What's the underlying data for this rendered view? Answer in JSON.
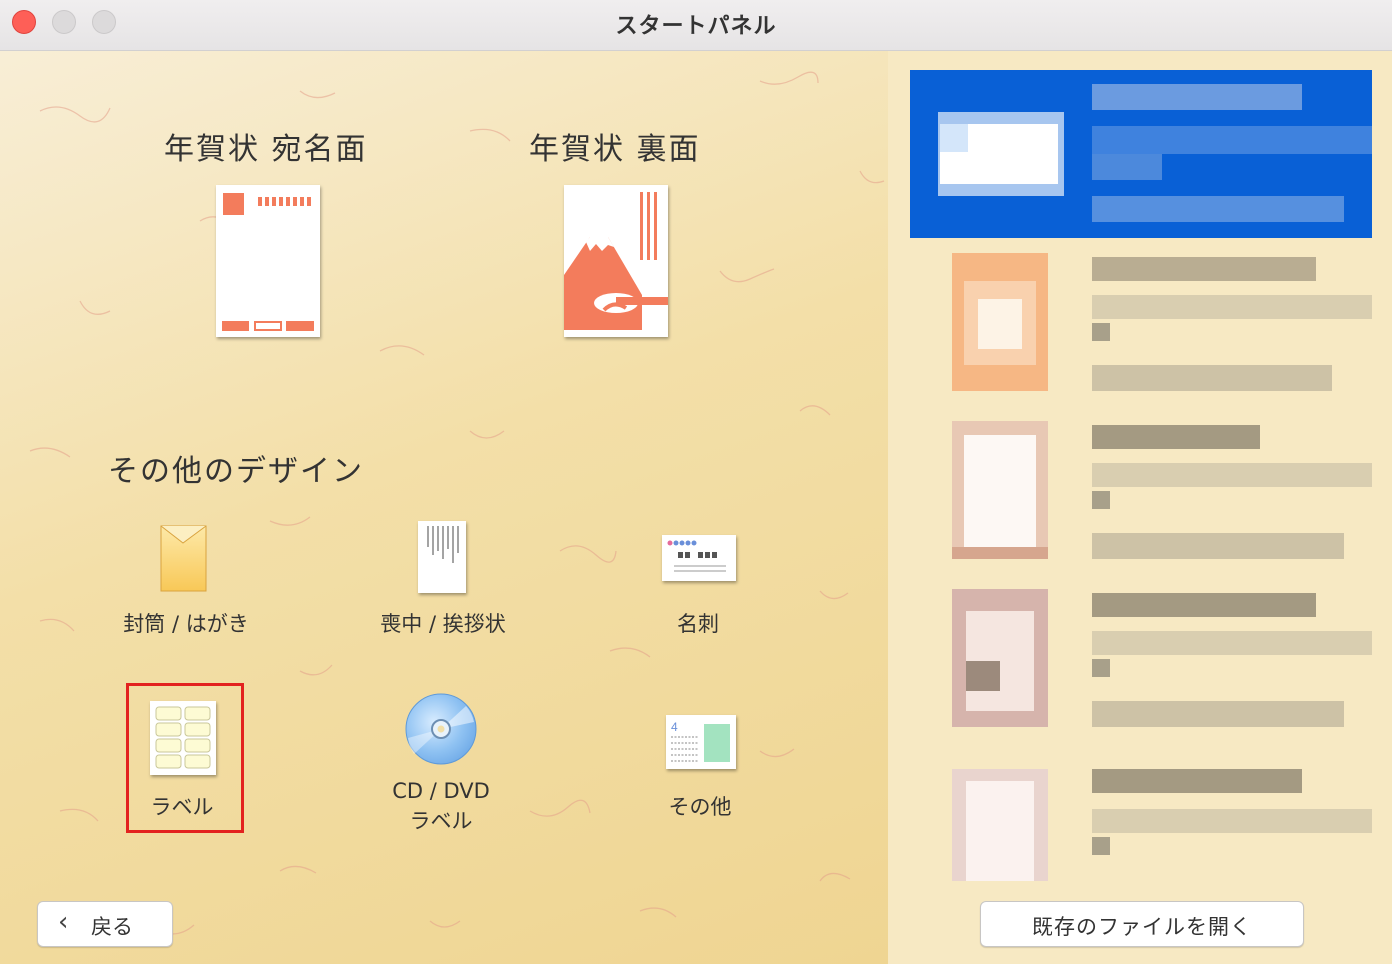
{
  "window": {
    "title": "スタートパネル"
  },
  "new_year": {
    "address_side": "年賀状  宛名面",
    "back_side": "年賀状  裏面"
  },
  "other": {
    "heading": "その他のデザイン",
    "envelope": "封筒 / はがき",
    "mourning": "喪中 / 挨拶状",
    "business_card": "名刺",
    "label": "ラベル",
    "cd_line1": "CD / DVD",
    "cd_line2": "ラベル",
    "others": "その他",
    "others_badge": "4"
  },
  "footer": {
    "back": "戻る",
    "open_existing": "既存のファイルを開く"
  },
  "colors": {
    "accent": "#f37c5c",
    "selection": "#0960d6",
    "highlight": "#e3221f"
  }
}
